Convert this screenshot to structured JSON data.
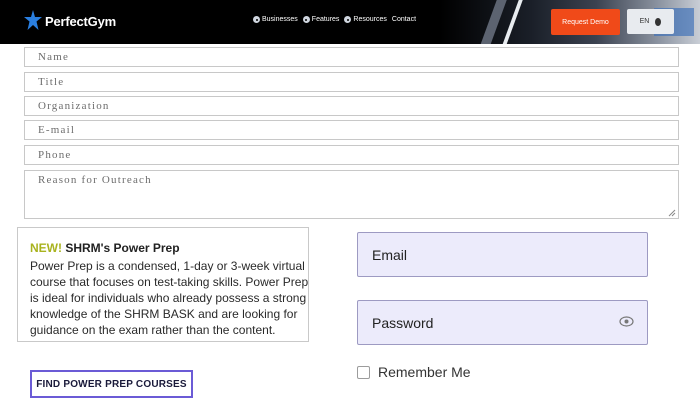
{
  "header": {
    "brand": "PerfectGym",
    "nav": [
      {
        "label": "Businesses",
        "icon": "globe-dot-icon"
      },
      {
        "label": "Features",
        "icon": "globe-dot-icon"
      },
      {
        "label": "Resources",
        "icon": "globe-dot-icon"
      },
      {
        "label": "Contact"
      }
    ],
    "request_demo_label": "Request Demo",
    "language_label": "EN",
    "accent_color": "#f04a19"
  },
  "form": {
    "name_placeholder": "Name",
    "title_placeholder": "Title",
    "organization_placeholder": "Organization",
    "email_placeholder": "E-mail",
    "phone_placeholder": "Phone",
    "reason_placeholder": "Reason for Outreach"
  },
  "promo": {
    "new_label": "NEW!",
    "title": "SHRM's Power Prep",
    "body": "Power Prep is a condensed, 1-day or 3-week virtual course that focuses on test-taking skills. Power Prep is ideal for individuals who already possess a strong knowledge of the SHRM BASK and are looking for guidance on the exam rather than the content.",
    "button_label": "FIND POWER PREP COURSES"
  },
  "login": {
    "email_placeholder": "Email",
    "password_placeholder": "Password",
    "remember_label": "Remember Me",
    "remember_checked": false
  }
}
